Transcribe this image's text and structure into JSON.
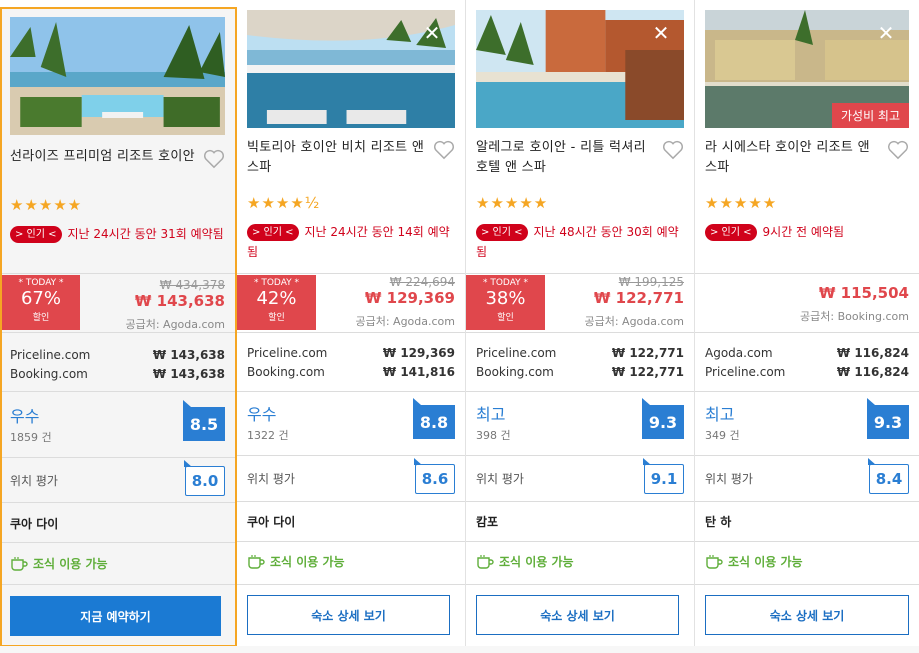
{
  "colors": {
    "accent": "#1b7ad3",
    "price_red": "#e0474c",
    "popular_red": "#d0021b",
    "score_blue": "#2a7ed3",
    "breakfast_green": "#5fae3a",
    "selected_border": "#f5a623"
  },
  "hotels": [
    {
      "name": "선라이즈 프리미엄 리조트 호이안",
      "stars": "★★★★★",
      "popular_tag": "> 인기 <",
      "popular_text": "지난 24시간 동안 31회 예약됨",
      "today_label": "* TODAY *",
      "discount": "67%",
      "discount_word": "할인",
      "original_price": "₩ 434,378",
      "price": "₩ 143,638",
      "supplier": "공급처: Agoda.com",
      "offers": [
        {
          "provider": "Priceline.com",
          "price": "₩ 143,638"
        },
        {
          "provider": "Booking.com",
          "price": "₩ 143,638"
        }
      ],
      "rating_word": "우수",
      "review_count": "1859 건",
      "score": "8.5",
      "location_label": "위치 평가",
      "location_score": "8.0",
      "area": "쿠아 다이",
      "breakfast": "조식 이용 가능",
      "cta": "지금 예약하기"
    },
    {
      "name": "빅토리아 호이안 비치 리조트 앤 스파",
      "stars": "★★★★½",
      "popular_tag": "> 인기 <",
      "popular_text": "지난 24시간 동안 14회 예약됨",
      "today_label": "* TODAY *",
      "discount": "42%",
      "discount_word": "할인",
      "original_price": "₩ 224,694",
      "price": "₩ 129,369",
      "supplier": "공급처: Agoda.com",
      "offers": [
        {
          "provider": "Priceline.com",
          "price": "₩ 129,369"
        },
        {
          "provider": "Booking.com",
          "price": "₩ 141,816"
        }
      ],
      "rating_word": "우수",
      "review_count": "1322 건",
      "score": "8.8",
      "location_label": "위치 평가",
      "location_score": "8.6",
      "area": "쿠아 다이",
      "breakfast": "조식 이용 가능",
      "cta": "숙소 상세 보기",
      "close": "✕"
    },
    {
      "name": "알레그로 호이안 - 리틀 럭셔리 호텔 앤 스파",
      "stars": "★★★★★",
      "popular_tag": "> 인기 <",
      "popular_text": "지난 48시간 동안 30회 예약됨",
      "today_label": "* TODAY *",
      "discount": "38%",
      "discount_word": "할인",
      "original_price": "₩ 199,125",
      "price": "₩ 122,771",
      "supplier": "공급처: Agoda.com",
      "offers": [
        {
          "provider": "Priceline.com",
          "price": "₩ 122,771"
        },
        {
          "provider": "Booking.com",
          "price": "₩ 122,771"
        }
      ],
      "rating_word": "최고",
      "review_count": "398 건",
      "score": "9.3",
      "location_label": "위치 평가",
      "location_score": "9.1",
      "area": "캄포",
      "breakfast": "조식 이용 가능",
      "cta": "숙소 상세 보기",
      "close": "✕"
    },
    {
      "name": "라 시에스타 호이안 리조트 앤 스파",
      "stars": "★★★★★",
      "popular_tag": "> 인기 <",
      "popular_text": "9시간 전 예약됨",
      "value_badge": "가성비 최고",
      "price": "₩ 115,504",
      "supplier": "공급처: Booking.com",
      "offers": [
        {
          "provider": "Agoda.com",
          "price": "₩ 116,824"
        },
        {
          "provider": "Priceline.com",
          "price": "₩ 116,824"
        }
      ],
      "rating_word": "최고",
      "review_count": "349 건",
      "score": "9.3",
      "location_label": "위치 평가",
      "location_score": "8.4",
      "area": "탄 하",
      "breakfast": "조식 이용 가능",
      "cta": "숙소 상세 보기",
      "close": "✕"
    }
  ]
}
